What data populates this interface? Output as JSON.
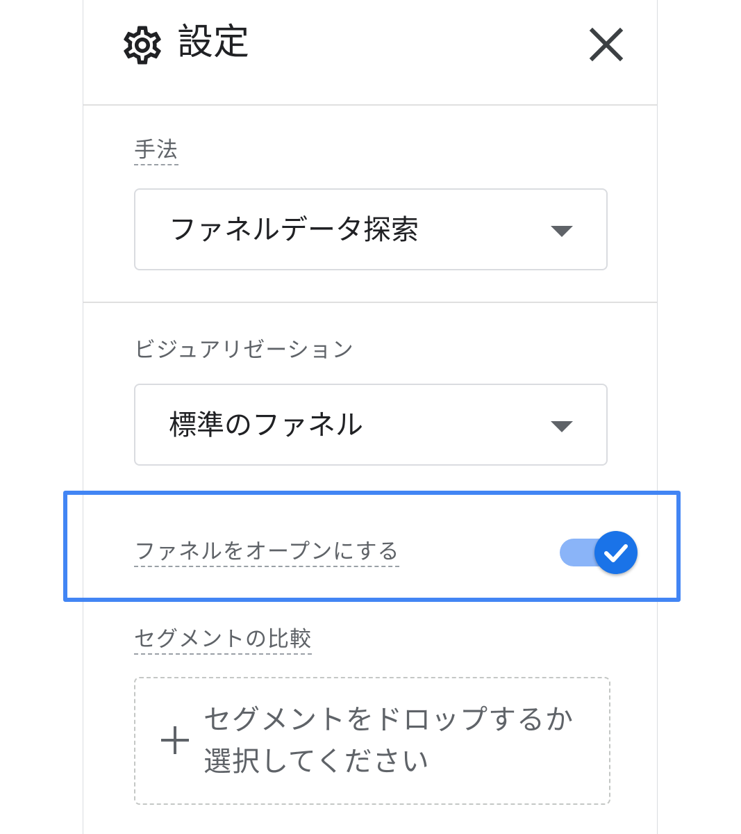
{
  "header": {
    "title": "設定",
    "settings_icon": "gear-icon",
    "close_icon": "close-icon"
  },
  "technique": {
    "label": "手法",
    "selected": "ファネルデータ探索"
  },
  "visualization": {
    "label": "ビジュアリゼーション",
    "selected": "標準のファネル"
  },
  "open_funnel": {
    "label": "ファネルをオープンにする",
    "enabled": true
  },
  "segment_comparison": {
    "label": "セグメントの比較",
    "dropzone_text": "セグメントをドロップするか選択してください",
    "add_icon": "plus-icon"
  },
  "colors": {
    "accent": "#1a73e8",
    "toggle_track": "#8ab4f8",
    "highlight_frame": "#4285f4"
  }
}
